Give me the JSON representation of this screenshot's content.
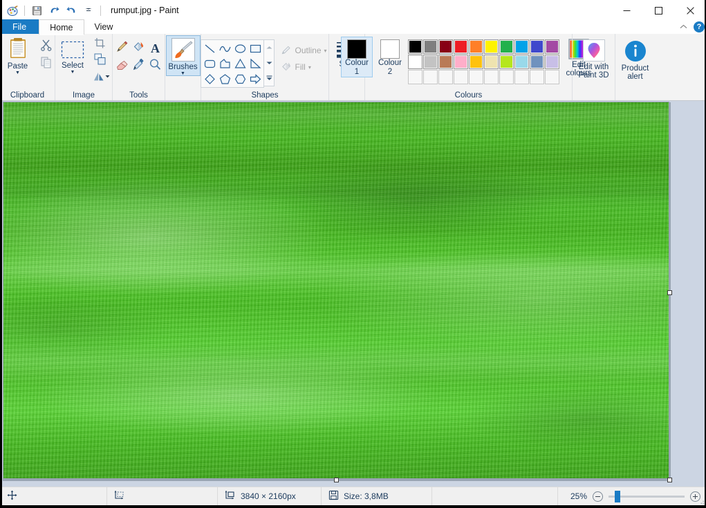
{
  "window": {
    "title": "rumput.jpg - Paint",
    "app_icon": "paint-palette-icon",
    "quick_access": [
      {
        "name": "save-icon",
        "label": "Save"
      },
      {
        "name": "undo-icon",
        "label": "Undo"
      },
      {
        "name": "redo-icon",
        "label": "Redo"
      },
      {
        "name": "customize-qat-icon",
        "label": "Customize Quick Access Toolbar"
      }
    ],
    "controls": {
      "minimize": "minimize-icon",
      "maximize": "maximize-icon",
      "close": "close-icon"
    }
  },
  "ribbon": {
    "tabs": [
      {
        "label": "File",
        "id": "file",
        "state": "file"
      },
      {
        "label": "Home",
        "id": "home",
        "state": "active"
      },
      {
        "label": "View",
        "id": "view",
        "state": "normal"
      }
    ],
    "collapse_icon": "chevron-up-icon",
    "help_icon": "help-icon",
    "help_label": "?",
    "groups": {
      "clipboard": {
        "label": "Clipboard",
        "paste": {
          "label": "Paste",
          "icon": "clipboard-icon",
          "dropdown": "▼"
        },
        "cut": {
          "label": "Cut",
          "icon": "scissors-icon"
        },
        "copy": {
          "label": "Copy",
          "icon": "copy-icon"
        }
      },
      "image": {
        "label": "Image",
        "select": {
          "label": "Select",
          "icon": "selection-marquee-icon",
          "dropdown": "▼"
        },
        "crop": {
          "label": "Crop",
          "icon": "crop-icon"
        },
        "resize": {
          "label": "Resize",
          "icon": "resize-icon"
        },
        "rotate": {
          "label": "Rotate",
          "icon": "rotate-icon",
          "dropdown": "▾"
        }
      },
      "tools": {
        "label": "Tools",
        "items": [
          {
            "label": "Pencil",
            "icon": "pencil-icon"
          },
          {
            "label": "Fill with colour",
            "icon": "fill-bucket-icon"
          },
          {
            "label": "Text",
            "icon": "text-a-icon"
          },
          {
            "label": "Eraser",
            "icon": "eraser-icon"
          },
          {
            "label": "Colour picker",
            "icon": "eyedropper-icon"
          },
          {
            "label": "Magnifier",
            "icon": "magnifier-icon"
          }
        ]
      },
      "brushes": {
        "label": "Brushes",
        "button_label": "Brushes",
        "icon": "paintbrush-icon",
        "dropdown": "▼",
        "selected": true
      },
      "shapes": {
        "label": "Shapes",
        "grid": [
          {
            "name": "line-shape",
            "icon": "line"
          },
          {
            "name": "curve-shape",
            "icon": "curve"
          },
          {
            "name": "oval-shape",
            "icon": "oval"
          },
          {
            "name": "rectangle-shape",
            "icon": "rectangle"
          },
          {
            "name": "rounded-rectangle-shape",
            "icon": "rounded-rect"
          },
          {
            "name": "polygon-shape",
            "icon": "polygon"
          },
          {
            "name": "triangle-shape",
            "icon": "triangle"
          },
          {
            "name": "right-triangle-shape",
            "icon": "right-triangle"
          },
          {
            "name": "diamond-shape",
            "icon": "diamond"
          },
          {
            "name": "pentagon-shape",
            "icon": "pentagon"
          },
          {
            "name": "hexagon-shape",
            "icon": "hexagon"
          },
          {
            "name": "right-arrow-shape",
            "icon": "arrow-right"
          }
        ],
        "scroll": {
          "up": "scroll-up-icon",
          "down": "scroll-down-icon",
          "more": "show-all-icon"
        },
        "outline": {
          "label": "Outline",
          "icon": "outline-pen-icon",
          "dropdown": "▾",
          "disabled": true
        },
        "fill": {
          "label": "Fill",
          "icon": "fill-bucket-icon",
          "dropdown": "▾",
          "disabled": true
        }
      },
      "size": {
        "label": "Size",
        "button_label": "Size",
        "icon": "line-thickness-icon",
        "dropdown": "▼"
      },
      "colours": {
        "label": "Colours",
        "colour1": {
          "label_line1": "Colour",
          "label_line2": "1",
          "value": "#000000",
          "selected": true
        },
        "colour2": {
          "label_line1": "Colour",
          "label_line2": "2",
          "value": "#ffffff",
          "selected": false
        },
        "row1": [
          "#000000",
          "#7f7f7f",
          "#880015",
          "#ed1c24",
          "#ff7f27",
          "#fff200",
          "#22b14c",
          "#00a2e8",
          "#3f48cc",
          "#a349a4"
        ],
        "row2": [
          "#ffffff",
          "#c3c3c3",
          "#b97a57",
          "#ffaec9",
          "#ffc20e",
          "#efe4b0",
          "#b5e61d",
          "#99d9ea",
          "#7092be",
          "#c8bfe7"
        ],
        "row3": [
          "",
          "",
          "",
          "",
          "",
          "",
          "",
          "",
          "",
          ""
        ],
        "edit_colours": {
          "line1": "Edit",
          "line2": "colours",
          "icon": "colour-spectrum-icon"
        }
      },
      "paint3d": {
        "line1": "Edit with",
        "line2": "Paint 3D",
        "icon": "paint3d-icon"
      },
      "product_alert": {
        "line1": "Product",
        "line2": "alert",
        "icon": "info-circle-icon",
        "glyph": "i"
      }
    }
  },
  "canvas": {
    "image_name": "rumput.jpg",
    "content_description": "green-grass-lawn-photo",
    "handles": [
      "right-middle",
      "bottom-center",
      "bottom-right"
    ]
  },
  "statusbar": {
    "cursor_position_icon": "cursor-position-icon",
    "cursor_position": "",
    "selection_size_icon": "selection-size-icon",
    "selection_size": "",
    "image_size_icon": "image-dimensions-icon",
    "image_size": "3840 × 2160px",
    "file_size_icon": "file-size-icon",
    "file_size": "Size: 3,8MB",
    "zoom": {
      "level": "25%",
      "zoom_out_icon": "zoom-out-icon",
      "zoom_in_icon": "zoom-in-icon",
      "slider_value": 25
    },
    "resize_grip_icon": "resize-grip-icon"
  }
}
